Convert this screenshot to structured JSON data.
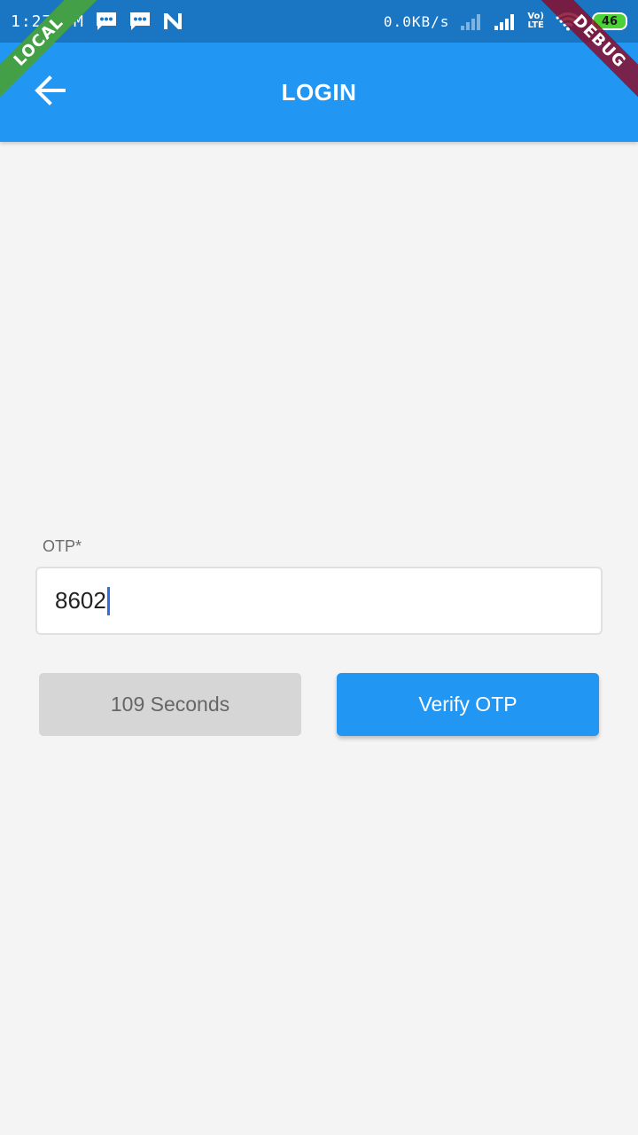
{
  "status_bar": {
    "time": "1:27 PM",
    "network_speed": "0.0KB/s",
    "volte_top": "Vo)",
    "volte_bottom": "LTE",
    "battery": "46",
    "icons": [
      "message-icon",
      "message-icon",
      "n-icon",
      "signal-weak-icon",
      "signal-icon",
      "wifi-icon",
      "battery-icon"
    ]
  },
  "banners": {
    "left": "LOCAL",
    "right": "DEBUG"
  },
  "app_bar": {
    "title": "LOGIN",
    "back_icon": "arrow-back-icon"
  },
  "form": {
    "otp_label": "OTP*",
    "otp_value": "8602",
    "timer_label": "109 Seconds",
    "verify_label": "Verify OTP"
  },
  "colors": {
    "status_bar": "#1a76c2",
    "app_bar": "#2196f3",
    "background": "#f4f4f4",
    "primary_button": "#2196f3",
    "disabled_button": "#d6d6d6",
    "local_banner": "#43a047",
    "debug_banner": "#880e2d"
  }
}
